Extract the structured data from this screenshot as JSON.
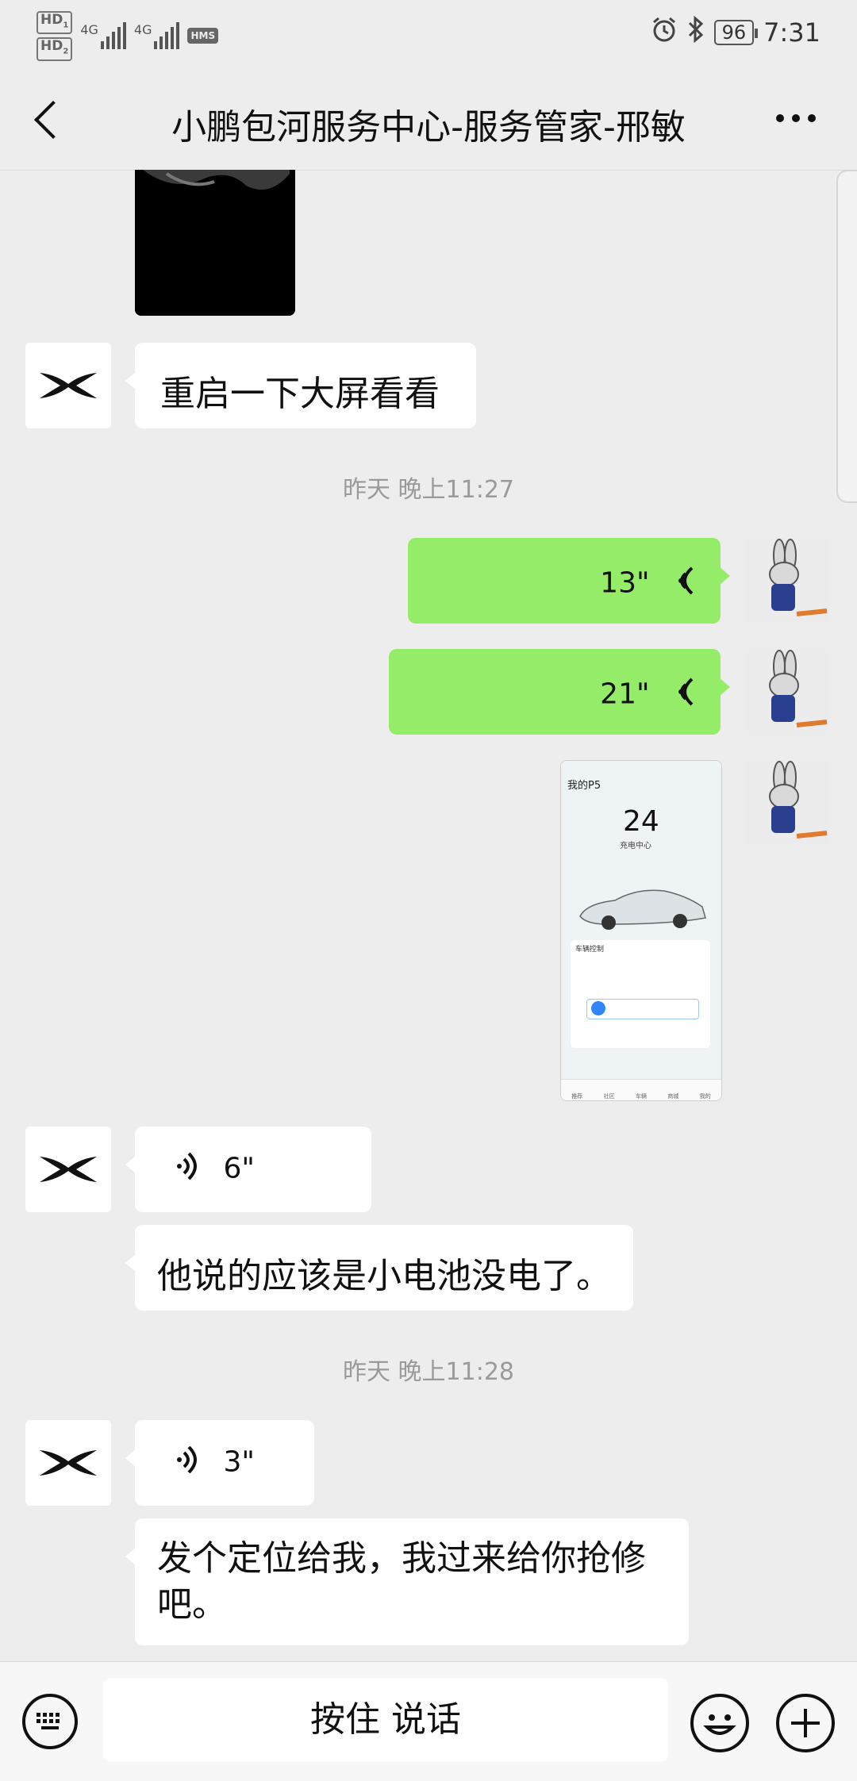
{
  "status_bar": {
    "hd1": "HD",
    "hd1_sub": "1",
    "hd2": "HD",
    "hd2_sub": "2",
    "net1": "4G",
    "net2": "4G",
    "hms": "HMS",
    "battery": "96",
    "time": "7:31",
    "icons": [
      "alarm-icon",
      "bluetooth-icon"
    ]
  },
  "header": {
    "title": "小鹏包河服务中心-服务管家-邢敏"
  },
  "messages": {
    "m1_text": "重启一下大屏看看",
    "ts1": "昨天 晚上11:27",
    "v1_duration": "13\"",
    "v2_duration": "21\"",
    "screenshot": {
      "car_name": "我的P5",
      "temp": "24",
      "charge": "充电中心",
      "section": "车辆控制",
      "tabs": [
        "推荐",
        "社区",
        "车辆",
        "商城",
        "我的"
      ]
    },
    "v3_duration": "6\"",
    "m2_text": "他说的应该是小电池没电了。",
    "ts2": "昨天 晚上11:28",
    "v4_duration": "3\"",
    "m3_text": "发个定位给我，我过来给你抢修吧。"
  },
  "input_bar": {
    "hold_to_talk": "按住 说话"
  },
  "colors": {
    "background": "#ededed",
    "self_bubble": "#95ec69",
    "other_bubble": "#ffffff",
    "timestamp": "#9a9a9a"
  }
}
